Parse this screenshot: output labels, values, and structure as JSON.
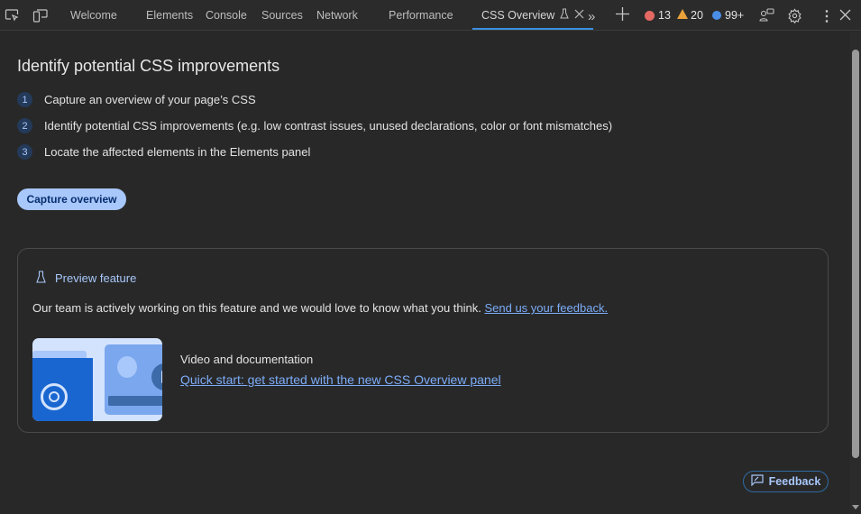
{
  "tabs": [
    {
      "label": "Welcome"
    },
    {
      "label": "Elements"
    },
    {
      "label": "Console"
    },
    {
      "label": "Sources"
    },
    {
      "label": "Network"
    },
    {
      "label": "Performance"
    },
    {
      "label": "CSS Overview",
      "active": true
    }
  ],
  "badges": {
    "errors": "13",
    "warnings": "20",
    "messages": "99+"
  },
  "main": {
    "title": "Identify potential CSS improvements",
    "steps": [
      {
        "n": "1",
        "text": "Capture an overview of your page’s CSS"
      },
      {
        "n": "2",
        "text": "Identify potential CSS improvements (e.g. low contrast issues, unused declarations, color or font mismatches)"
      },
      {
        "n": "3",
        "text": "Locate the affected elements in the Elements panel"
      }
    ],
    "capture_label": "Capture overview"
  },
  "preview": {
    "heading": "Preview feature",
    "text": "Our team is actively working on this feature and we would love to know what you think.",
    "feedback_link": "Send us your feedback.",
    "video_heading": "Video and documentation",
    "video_link": "Quick start: get started with the new CSS Overview panel"
  },
  "feedback_label": "Feedback",
  "colors": {
    "accent": "#3b8fe0",
    "link": "#7cacf8",
    "button": "#a8c7fa"
  }
}
